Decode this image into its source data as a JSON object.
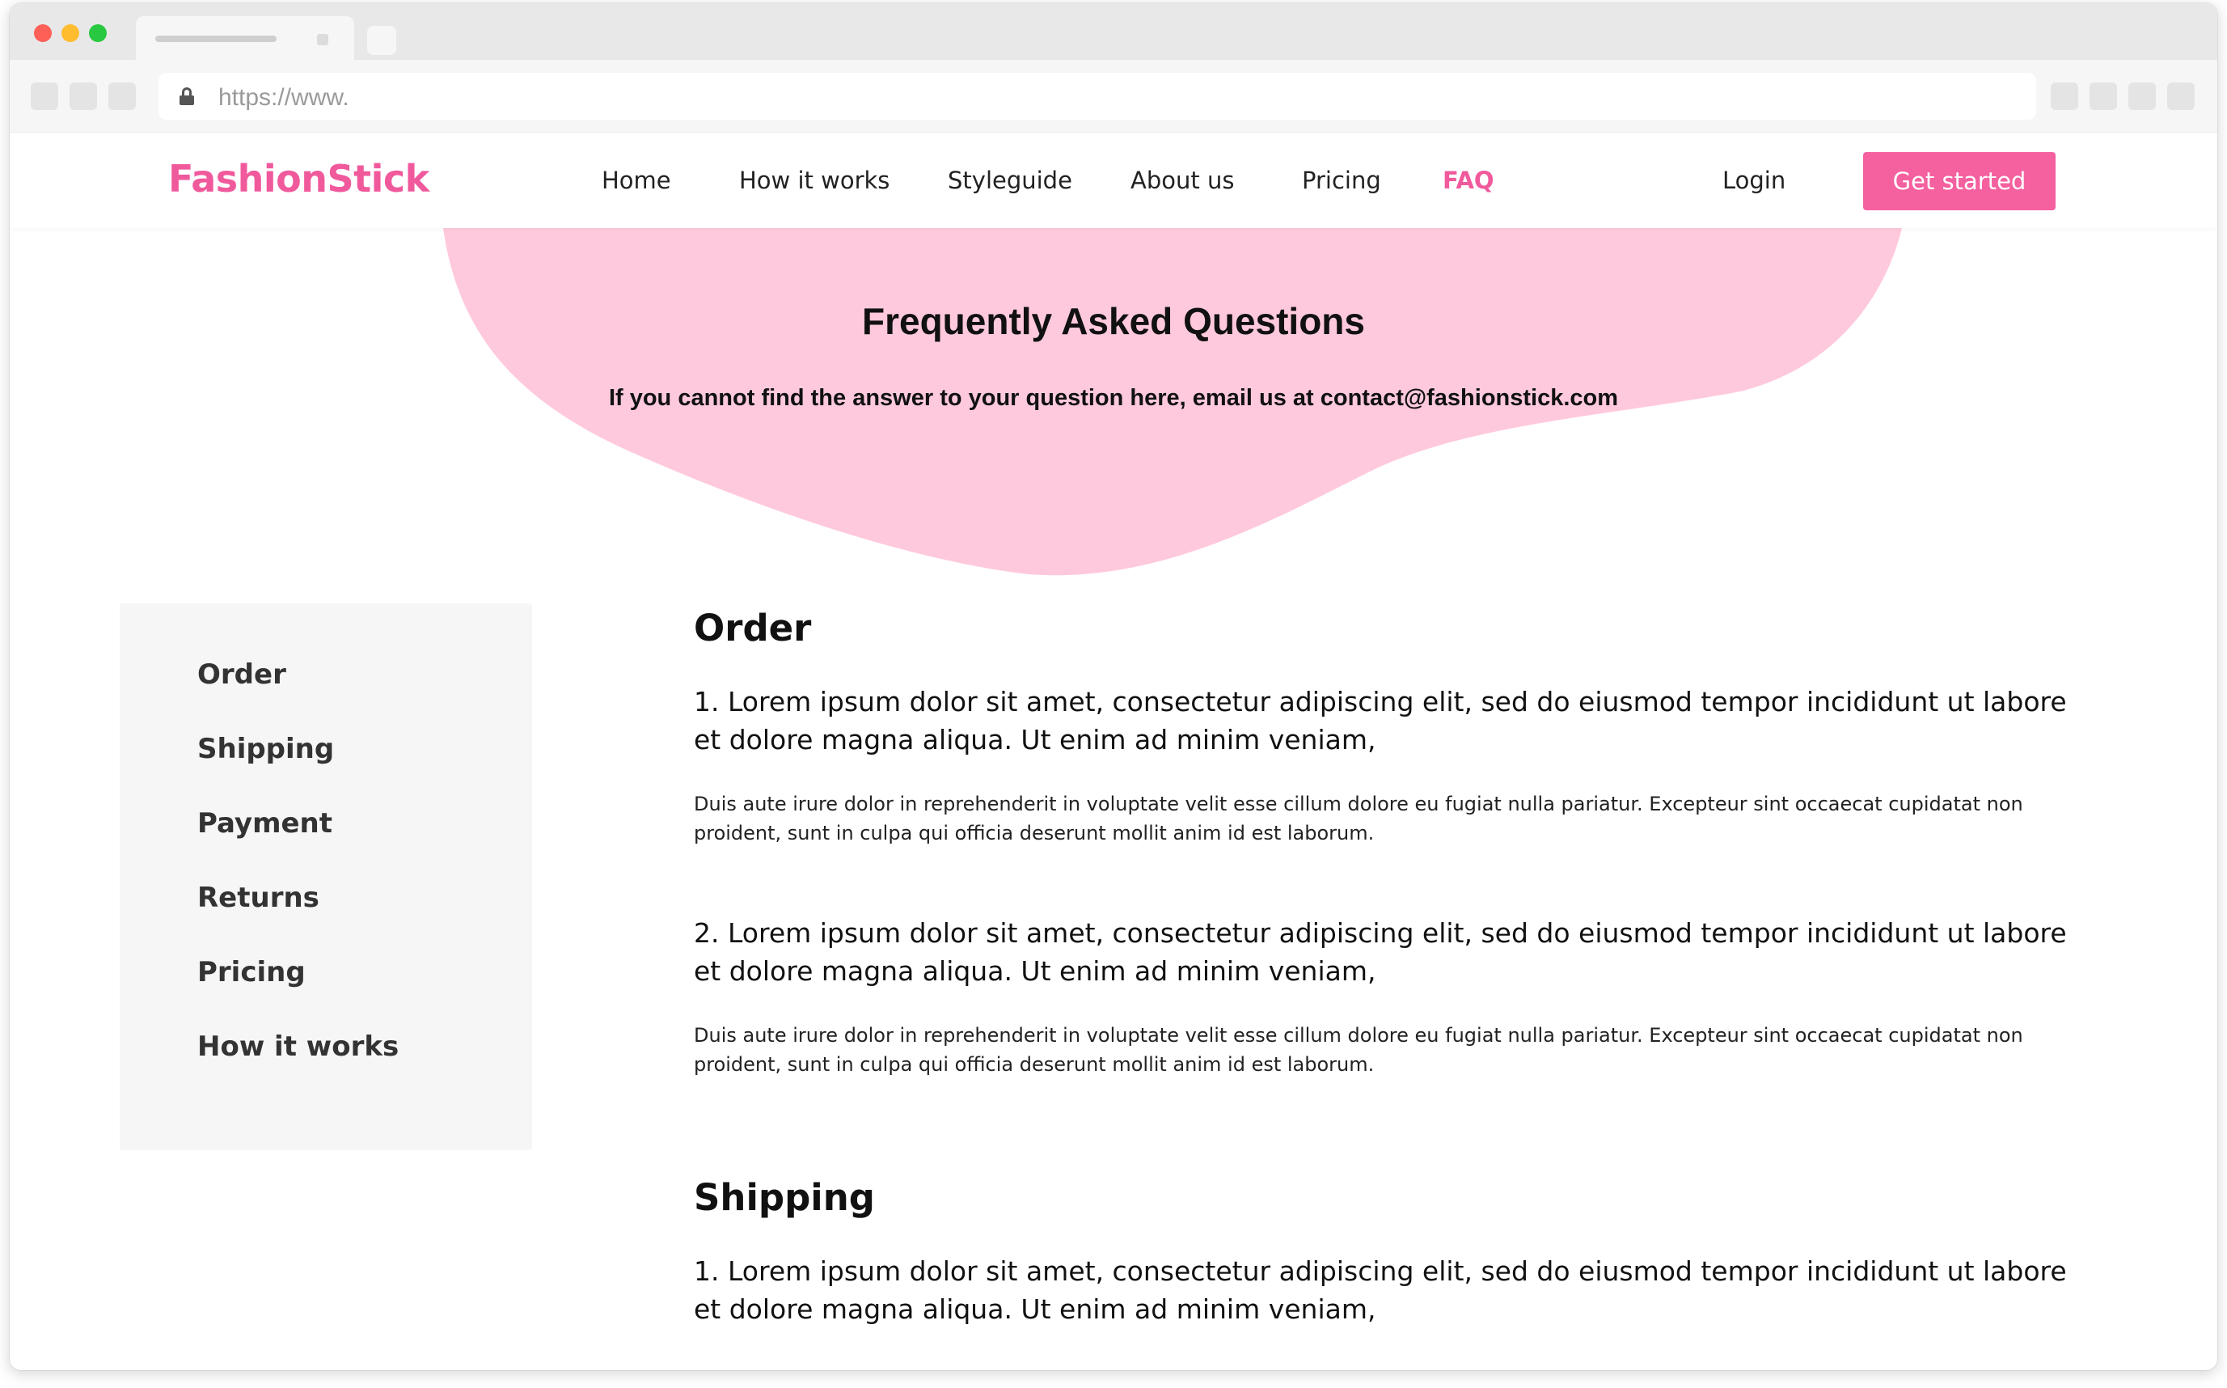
{
  "browser": {
    "url_text": "https://www."
  },
  "header": {
    "logo": "FashionStick",
    "nav": [
      {
        "label": "Home"
      },
      {
        "label": "How it works"
      },
      {
        "label": "Styleguide"
      },
      {
        "label": "About us"
      },
      {
        "label": "Pricing"
      },
      {
        "label": "FAQ",
        "active": true
      }
    ],
    "login_label": "Login",
    "cta_label": "Get started"
  },
  "hero": {
    "title": "Frequently Asked Questions",
    "subtitle": "If you cannot find the answer to your question here, email us at contact@fashionstick.com"
  },
  "sidebar": {
    "items": [
      {
        "label": "Order"
      },
      {
        "label": "Shipping"
      },
      {
        "label": "Payment"
      },
      {
        "label": "Returns"
      },
      {
        "label": "Pricing"
      },
      {
        "label": "How it works"
      }
    ]
  },
  "sections": [
    {
      "title": "Order",
      "items": [
        {
          "question": "1. Lorem ipsum dolor sit amet, consectetur adipiscing elit, sed do eiusmod tempor incididunt ut labore et dolore magna aliqua. Ut enim ad minim veniam,",
          "answer": "Duis aute irure dolor in reprehenderit in voluptate velit esse cillum dolore eu fugiat nulla pariatur. Excepteur sint occaecat cupidatat non proident, sunt in culpa qui officia deserunt mollit anim id est laborum."
        },
        {
          "question": "2. Lorem ipsum dolor sit amet, consectetur adipiscing elit, sed do eiusmod tempor incididunt ut labore et dolore magna aliqua. Ut enim ad minim veniam,",
          "answer": "Duis aute irure dolor in reprehenderit in voluptate velit esse cillum dolore eu fugiat nulla pariatur. Excepteur sint occaecat cupidatat non proident, sunt in culpa qui officia deserunt mollit anim id est laborum."
        }
      ]
    },
    {
      "title": "Shipping",
      "items": [
        {
          "question": "1. Lorem ipsum dolor sit amet, consectetur adipiscing elit, sed do eiusmod tempor incididunt ut labore et dolore magna aliqua. Ut enim ad minim veniam,"
        }
      ]
    }
  ],
  "colors": {
    "brand": "#f05a9c",
    "cta": "#f5609f",
    "hero_blob": "#ffc9dd",
    "sidebar_bg": "#f6f6f6"
  }
}
